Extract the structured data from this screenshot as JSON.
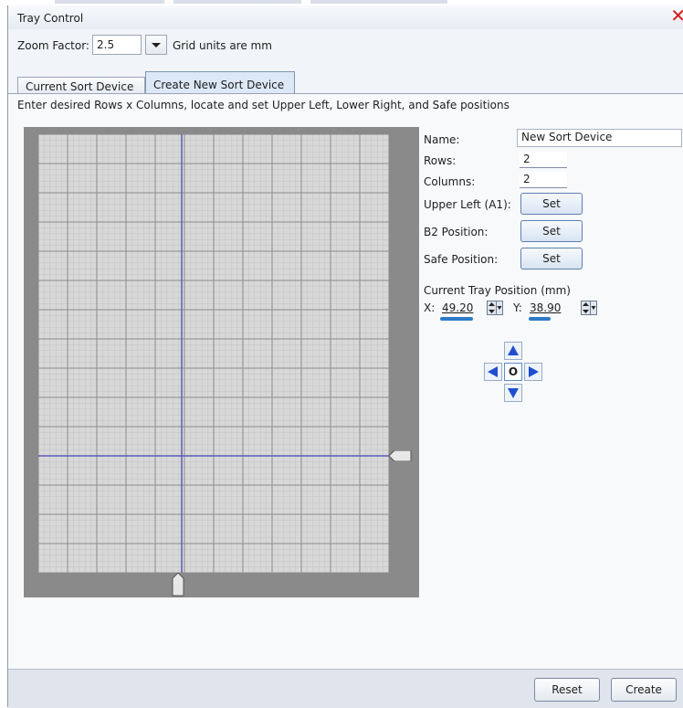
{
  "window": {
    "title": "Tray Control"
  },
  "zoom": {
    "label": "Zoom Factor:",
    "value": "2.5",
    "units_note": "Grid units are mm"
  },
  "tabs": [
    {
      "label": "Current Sort Device",
      "active": false
    },
    {
      "label": "Create New Sort Device",
      "active": true
    }
  ],
  "instructions": "Enter desired Rows x Columns, locate and set Upper Left, Lower Right, and Safe positions",
  "form": {
    "name_label": "Name:",
    "name_value": "New Sort Device",
    "rows_label": "Rows:",
    "rows_value": "2",
    "columns_label": "Columns:",
    "columns_value": "2",
    "upper_left_label": "Upper Left (A1):",
    "b2_label": "B2 Position:",
    "safe_label": "Safe Position:",
    "set_label": "Set"
  },
  "tray_position": {
    "header": "Current Tray Position (mm)",
    "x_label": "X:",
    "x_value": "49.20",
    "y_label": "Y:",
    "y_value": "38.90"
  },
  "dpad": {
    "center_label": "O"
  },
  "footer": {
    "reset_label": "Reset",
    "create_label": "Create"
  },
  "colors": {
    "accent": "#2d79c7",
    "close": "#d21c1c",
    "grid_bg": "#d8d8d8",
    "crosshair": "#5b5bb8"
  }
}
